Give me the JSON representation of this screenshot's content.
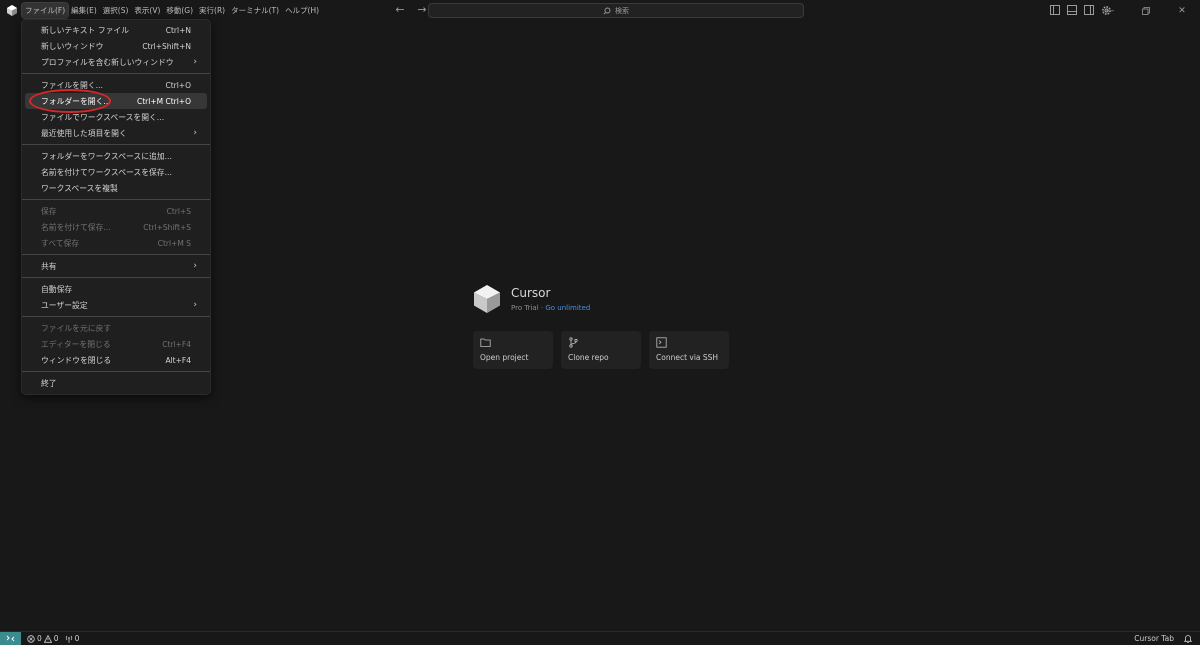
{
  "menubar": {
    "items": [
      {
        "label": "ファイル(F)",
        "active": true
      },
      {
        "label": "編集(E)"
      },
      {
        "label": "選択(S)"
      },
      {
        "label": "表示(V)"
      },
      {
        "label": "移動(G)"
      },
      {
        "label": "実行(R)"
      },
      {
        "label": "ターミナル(T)"
      },
      {
        "label": "ヘルプ(H)"
      }
    ]
  },
  "search": {
    "placeholder": "検索"
  },
  "file_menu": {
    "groups": [
      [
        {
          "label": "新しいテキスト ファイル",
          "shortcut": "Ctrl+N"
        },
        {
          "label": "新しいウィンドウ",
          "shortcut": "Ctrl+Shift+N"
        },
        {
          "label": "プロファイルを含む新しいウィンドウ",
          "submenu": true
        }
      ],
      [
        {
          "label": "ファイルを開く...",
          "shortcut": "Ctrl+O"
        },
        {
          "label": "フォルダーを開く...",
          "shortcut": "Ctrl+M Ctrl+O",
          "selected": true
        },
        {
          "label": "ファイルでワークスペースを開く..."
        },
        {
          "label": "最近使用した項目を開く",
          "submenu": true
        }
      ],
      [
        {
          "label": "フォルダーをワークスペースに追加..."
        },
        {
          "label": "名前を付けてワークスペースを保存..."
        },
        {
          "label": "ワークスペースを複製"
        }
      ],
      [
        {
          "label": "保存",
          "shortcut": "Ctrl+S",
          "disabled": true
        },
        {
          "label": "名前を付けて保存...",
          "shortcut": "Ctrl+Shift+S",
          "disabled": true
        },
        {
          "label": "すべて保存",
          "shortcut": "Ctrl+M S",
          "disabled": true
        }
      ],
      [
        {
          "label": "共有",
          "submenu": true
        }
      ],
      [
        {
          "label": "自動保存"
        },
        {
          "label": "ユーザー設定",
          "submenu": true
        }
      ],
      [
        {
          "label": "ファイルを元に戻す",
          "disabled": true
        },
        {
          "label": "エディターを閉じる",
          "shortcut": "Ctrl+F4",
          "disabled": true
        },
        {
          "label": "ウィンドウを閉じる",
          "shortcut": "Alt+F4"
        }
      ],
      [
        {
          "label": "終了"
        }
      ]
    ]
  },
  "welcome": {
    "name": "Cursor",
    "plan": "Pro Trial",
    "separator": "·",
    "upgrade_link": "Go unlimited",
    "actions": [
      {
        "label": "Open project",
        "icon": "folder-icon"
      },
      {
        "label": "Clone repo",
        "icon": "git-branch-icon"
      },
      {
        "label": "Connect via SSH",
        "icon": "terminal-icon"
      }
    ]
  },
  "statusbar": {
    "errors": "0",
    "warnings": "0",
    "ports": "0",
    "cursor_tab": "Cursor Tab"
  },
  "colors": {
    "background": "#181818",
    "menu_bg": "#1f1f1f",
    "accent_link": "#4b8fd8",
    "remote_button": "#3c8c8f",
    "highlight_circle": "#d62828"
  }
}
